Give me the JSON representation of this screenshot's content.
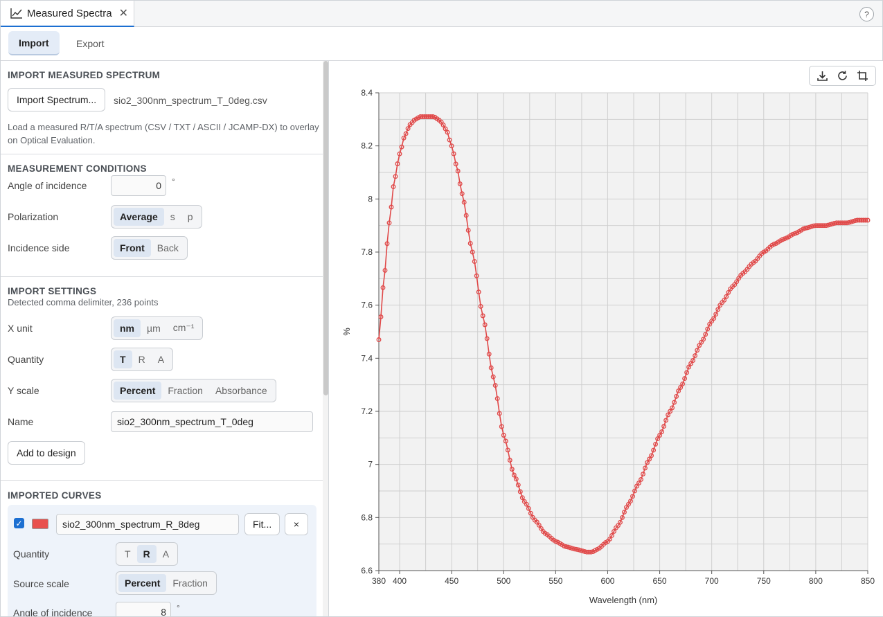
{
  "tab": {
    "title": "Measured Spectra",
    "close": "✕",
    "help": "?"
  },
  "subtabs": {
    "import": "Import",
    "export": "Export"
  },
  "import_section": {
    "title": "IMPORT MEASURED SPECTRUM",
    "button": "Import Spectrum...",
    "filename": "sio2_300nm_spectrum_T_0deg.csv",
    "note": "Load a measured R/T/A spectrum (CSV / TXT / ASCII / JCAMP-DX) to overlay on Optical Evaluation."
  },
  "conditions": {
    "title": "MEASUREMENT CONDITIONS",
    "angle_label": "Angle of incidence",
    "angle_value": "0",
    "angle_unit": "°",
    "polarization_label": "Polarization",
    "polarization_options": [
      "Average",
      "s",
      "p"
    ],
    "polarization_selected": "Average",
    "side_label": "Incidence side",
    "side_options": [
      "Front",
      "Back"
    ],
    "side_selected": "Front"
  },
  "settings": {
    "title": "IMPORT SETTINGS",
    "detected": "Detected comma delimiter, 236 points",
    "xunit_label": "X unit",
    "xunit_options": [
      "nm",
      "µm",
      "cm⁻¹"
    ],
    "xunit_selected": "nm",
    "quantity_label": "Quantity",
    "quantity_options": [
      "T",
      "R",
      "A"
    ],
    "quantity_selected": "T",
    "yscale_label": "Y scale",
    "yscale_options": [
      "Percent",
      "Fraction",
      "Absorbance"
    ],
    "yscale_selected": "Percent",
    "name_label": "Name",
    "name_value": "sio2_300nm_spectrum_T_0deg",
    "add_button": "Add to design"
  },
  "imported": {
    "title": "IMPORTED CURVES",
    "curve": {
      "checked": true,
      "color": "#e8504d",
      "name": "sio2_300nm_spectrum_R_8deg",
      "fit_button": "Fit...",
      "remove_button": "×",
      "quantity_label": "Quantity",
      "quantity_options": [
        "T",
        "R",
        "A"
      ],
      "quantity_selected": "R",
      "source_label": "Source scale",
      "source_options": [
        "Percent",
        "Fraction"
      ],
      "source_selected": "Percent",
      "angle_label": "Angle of incidence",
      "angle_value": "8",
      "angle_unit": "°"
    }
  },
  "tools": [
    "download-icon",
    "refresh-icon",
    "crop-icon"
  ],
  "chart_data": {
    "type": "line",
    "xlabel": "Wavelength (nm)",
    "ylabel": "%",
    "xlim": [
      380,
      850
    ],
    "ylim": [
      6.6,
      8.4
    ],
    "xticks": [
      380,
      400,
      450,
      500,
      550,
      600,
      650,
      700,
      750,
      800,
      850
    ],
    "yticks": [
      "6.6",
      "6.8",
      "7",
      "7.2",
      "7.4",
      "7.6",
      "7.8",
      "8",
      "8.2",
      "8.4"
    ],
    "grid": true,
    "series": [
      {
        "color": "#e04848",
        "points": 236,
        "x": [
          380,
          385,
          390,
          395,
          400,
          405,
          410,
          415,
          420,
          425,
          430,
          433,
          437,
          440,
          445,
          450,
          455,
          460,
          470,
          480,
          490,
          500,
          510,
          520,
          530,
          540,
          550,
          560,
          570,
          580,
          585,
          590,
          600,
          610,
          620,
          630,
          640,
          650,
          660,
          670,
          680,
          690,
          700,
          710,
          720,
          730,
          740,
          750,
          760,
          770,
          780,
          790,
          800,
          810,
          820,
          830,
          840,
          850
        ],
        "y": [
          7.47,
          7.7,
          7.91,
          8.07,
          8.17,
          8.24,
          8.28,
          8.3,
          8.31,
          8.31,
          8.31,
          8.31,
          8.3,
          8.29,
          8.26,
          8.2,
          8.12,
          8.02,
          7.8,
          7.56,
          7.33,
          7.11,
          6.96,
          6.86,
          6.79,
          6.74,
          6.71,
          6.69,
          6.68,
          6.67,
          6.67,
          6.68,
          6.71,
          6.77,
          6.85,
          6.93,
          7.02,
          7.11,
          7.2,
          7.29,
          7.38,
          7.46,
          7.54,
          7.61,
          7.67,
          7.72,
          7.76,
          7.8,
          7.83,
          7.85,
          7.87,
          7.89,
          7.9,
          7.9,
          7.91,
          7.91,
          7.92,
          7.92
        ]
      }
    ]
  }
}
